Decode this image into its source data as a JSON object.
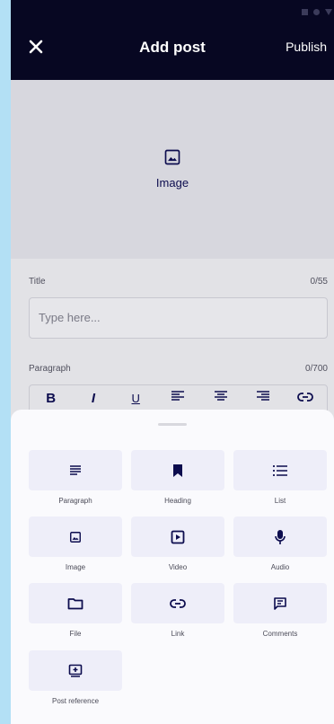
{
  "header": {
    "title": "Add post",
    "publish_label": "Publish",
    "close_icon": "close-icon"
  },
  "image_picker": {
    "label": "Image",
    "icon": "image-icon"
  },
  "form": {
    "title_label": "Title",
    "title_counter": "0/55",
    "title_placeholder": "Type here...",
    "paragraph_label": "Paragraph",
    "paragraph_counter": "0/700",
    "toolbar": {
      "bold": "B",
      "italic": "I",
      "underline": "U"
    }
  },
  "sheet": {
    "items": [
      {
        "label": "Paragraph",
        "icon": "paragraph-icon"
      },
      {
        "label": "Heading",
        "icon": "bookmark-icon"
      },
      {
        "label": "List",
        "icon": "list-icon"
      },
      {
        "label": "Image",
        "icon": "image-icon"
      },
      {
        "label": "Video",
        "icon": "video-icon"
      },
      {
        "label": "Audio",
        "icon": "microphone-icon"
      },
      {
        "label": "File",
        "icon": "folder-icon"
      },
      {
        "label": "Link",
        "icon": "link-icon"
      },
      {
        "label": "Comments",
        "icon": "comment-icon"
      },
      {
        "label": "Post reference",
        "icon": "post-reference-icon"
      }
    ]
  },
  "colors": {
    "header_bg": "#070722",
    "accent": "#0c0c4e",
    "tile_bg": "#eeeef9"
  }
}
